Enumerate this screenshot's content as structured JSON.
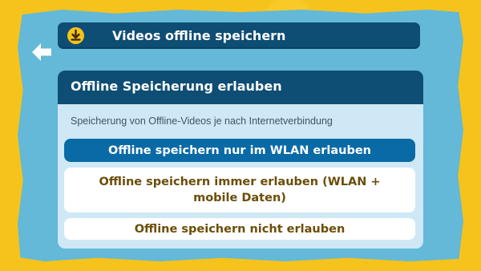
{
  "colors": {
    "background": "#f6c31c",
    "panel": "#63b9d7",
    "header": "#0e4d74",
    "card": "#cfe8f5",
    "selected_option": "#0a6aa6",
    "option_text": "#6b4d08"
  },
  "header": {
    "icon": "download-icon",
    "title": "Videos offline speichern"
  },
  "back": {
    "icon": "back-arrow-icon"
  },
  "settings_card": {
    "title": "Offline Speicherung erlauben",
    "description": "Speicherung von Offline-Videos je nach Internetverbindung",
    "options": [
      {
        "label": "Offline speichern nur im WLAN erlauben",
        "selected": true
      },
      {
        "label": "Offline speichern immer erlauben (WLAN + mobile Daten)",
        "selected": false
      },
      {
        "label": "Offline speichern nicht erlauben",
        "selected": false
      }
    ]
  }
}
